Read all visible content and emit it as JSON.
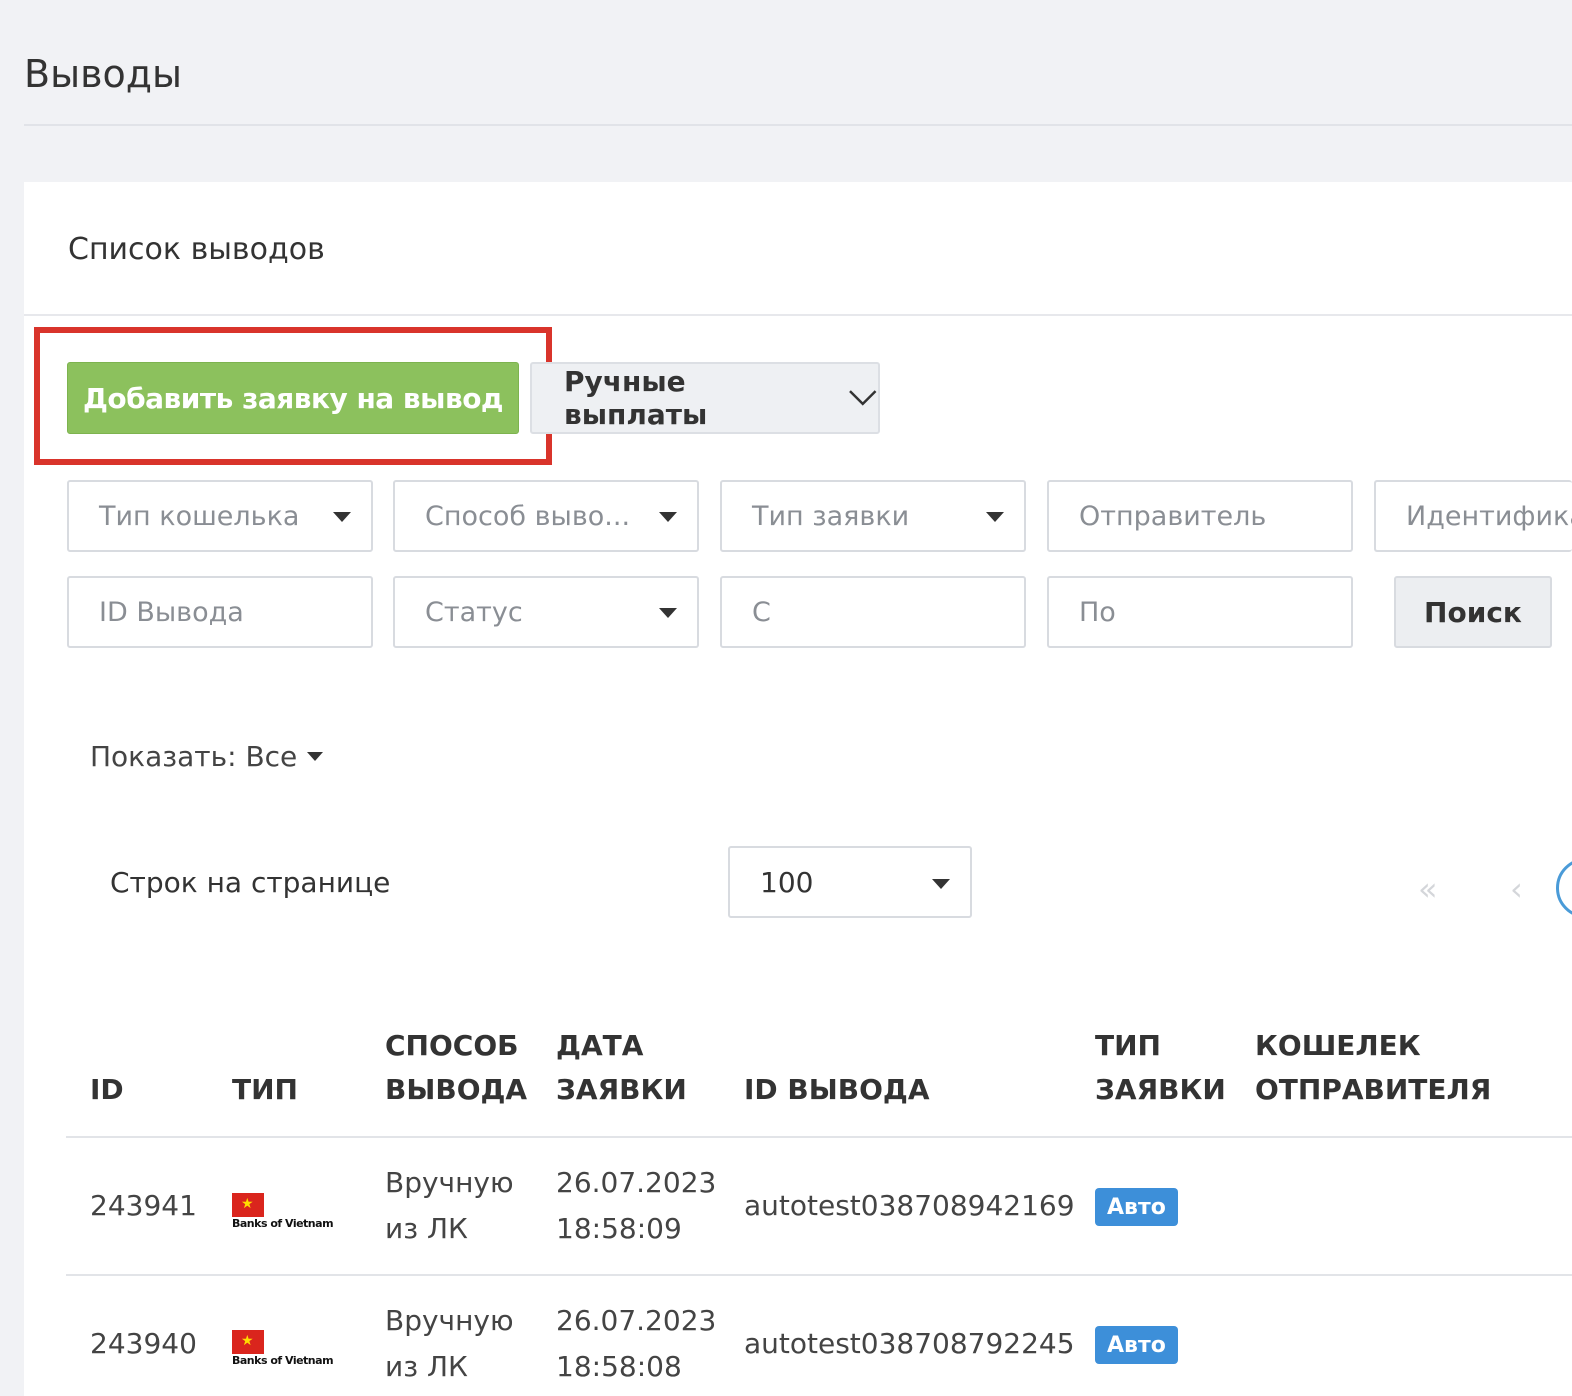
{
  "page": {
    "title": "Выводы"
  },
  "panel": {
    "title": "Список выводов"
  },
  "toolbar": {
    "add_label": "Добавить заявку на вывод",
    "manual_label": "Ручные выплаты"
  },
  "filters": {
    "wallet_type": "Тип кошелька",
    "method": "Способ выво...",
    "request_type": "Тип заявки",
    "sender": "Отправитель",
    "identifier": "Идентифика",
    "withdraw_id": "ID Вывода",
    "status": "Статус",
    "date_from": "С",
    "date_to": "По",
    "search_label": "Поиск"
  },
  "show": {
    "label": "Показать: Все"
  },
  "pagination": {
    "rows_label": "Строк на странице",
    "rows_value": "100",
    "first_icon": "«",
    "prev_icon": "‹"
  },
  "table": {
    "headers": {
      "id": "ID",
      "type": "ТИП",
      "method_1": "СПОСОБ",
      "method_2": "ВЫВОДА",
      "date_1": "ДАТА",
      "date_2": "ЗАЯВКИ",
      "withdraw_id": "ID ВЫВОДА",
      "req_type_1": "ТИП",
      "req_type_2": "ЗАЯВКИ",
      "wallet_1": "КОШЕЛЕК",
      "wallet_2": "ОТПРАВИТЕЛЯ"
    },
    "rows": [
      {
        "id": "243941",
        "bank": "Banks of Vietnam",
        "method_1": "Вручную",
        "method_2": "из ЛК",
        "date": "26.07.2023",
        "time": "18:58:09",
        "withdraw_id": "autotest038708942169",
        "request_type": "Авто"
      },
      {
        "id": "243940",
        "bank": "Banks of Vietnam",
        "method_1": "Вручную",
        "method_2": "из ЛК",
        "date": "26.07.2023",
        "time": "18:58:08",
        "withdraw_id": "autotest038708792245",
        "request_type": "Авто"
      }
    ]
  },
  "colors": {
    "add_button": "#8cc15d",
    "highlight": "#d9342b",
    "badge": "#3d8fd9"
  }
}
